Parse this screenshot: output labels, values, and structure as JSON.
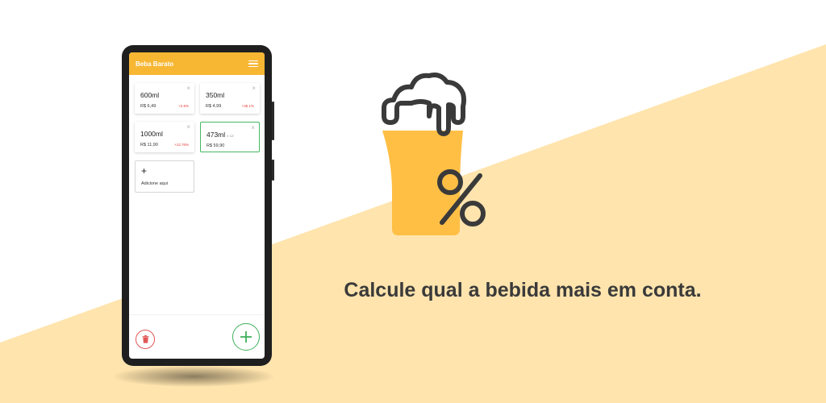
{
  "colors": {
    "accent": "#f7b733",
    "diagonal_fill": "#ffe4ad",
    "beer": "#ffbf45",
    "outline": "#3a3a3a",
    "positive": "#3fb05a",
    "danger": "#e05656"
  },
  "app": {
    "title": "Beba Barato",
    "menu_icon": "hamburger-menu-icon"
  },
  "cards": [
    {
      "volume": "600ml",
      "unit": "",
      "price": "R$ 6,49",
      "percent": "+2.5%",
      "selected": false
    },
    {
      "volume": "350ml",
      "unit": "",
      "price": "R$ 4,99",
      "percent": "+35.1%",
      "selected": false
    },
    {
      "volume": "1000ml",
      "unit": "",
      "price": "R$ 11,90",
      "percent": "+12.76%",
      "selected": false
    },
    {
      "volume": "473ml",
      "unit": "x 12",
      "price": "R$ 59,90",
      "percent": "",
      "selected": true
    }
  ],
  "add_card": {
    "label": "Adicione aqui"
  },
  "close_glyph": "×",
  "plus_glyph": "+",
  "tagline": "Calcule qual a bebida mais em conta."
}
